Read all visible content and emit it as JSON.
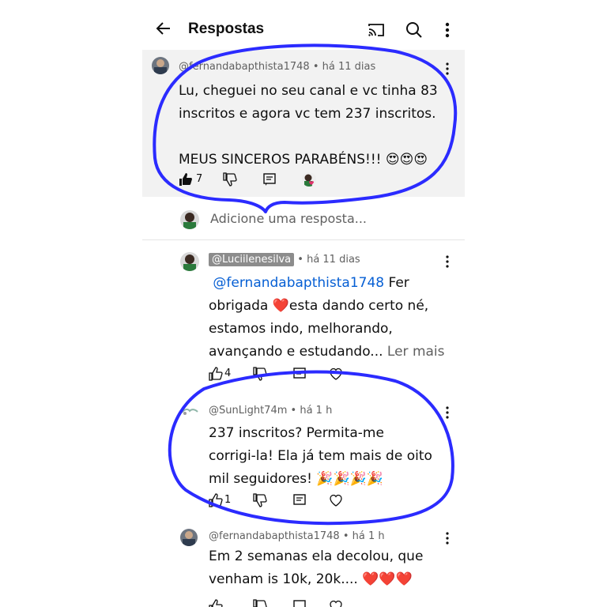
{
  "header": {
    "title": "Respostas",
    "icons": [
      "back-arrow-icon",
      "cast-icon",
      "search-icon",
      "more-vertical-icon"
    ]
  },
  "parent_comment": {
    "author": "@fernandabapthista1748",
    "time": "há 11 dias",
    "text_line1": "Lu, cheguei no seu canal e vc tinha 83",
    "text_line2": "inscritos e agora vc tem 237 inscritos.",
    "text_line3": "MEUS SINCEROS PARABÉNS!!! 😍😍😍",
    "likes": "7"
  },
  "reply_input": {
    "placeholder": "Adicione uma resposta..."
  },
  "replies": [
    {
      "author": "@Luciilenesilva",
      "time": "há 11 dias",
      "mention": "@fernandabapthista1748",
      "text_after_mention": " Fer",
      "line2": "obrigada ❤️esta dando certo né,",
      "line3": "estamos indo, melhorando,",
      "line4": "avançando e estudando... ",
      "read_more": "Ler mais",
      "likes": "4"
    },
    {
      "author": "@SunLight74m",
      "time": "há 1 h",
      "line1": "237 inscritos? Permita-me",
      "line2": "corrigi-la! Ela já tem mais de oito",
      "line3": "mil seguidores! 🎉🎉🎉🎉",
      "likes": "1"
    },
    {
      "author": "@fernandabapthista1748",
      "time": "há 1 h",
      "line1": "Em 2 semanas ela decolou, que",
      "line2": "venham is 10k, 20k.... ❤️❤️❤️"
    }
  ],
  "colors": {
    "annotation": "#2b2bff",
    "mention": "#065fd4",
    "highlight_bg": "#f2f2f2"
  }
}
